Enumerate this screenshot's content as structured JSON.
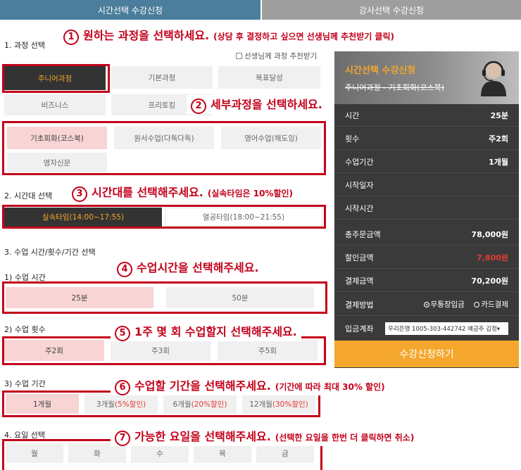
{
  "tabs": [
    "시간선택 수강신청",
    "강사선택 수강신청"
  ],
  "callouts": {
    "c1": {
      "num": "1",
      "text": "원하는 과정을 선택하세요.",
      "note": "(상담 후 결정하고 싶으면 선생님께 추천받기 클릭)"
    },
    "c2": {
      "num": "2",
      "text": "세부과정을 선택하세요.",
      "note": ""
    },
    "c3": {
      "num": "3",
      "text": "시간대를 선택해주세요.",
      "note": "(실속타임은 10%할인)"
    },
    "c4": {
      "num": "4",
      "text": "수업시간을 선택해주세요.",
      "note": ""
    },
    "c5": {
      "num": "5",
      "text": "1주 몇 회 수업할지 선택해주세요.",
      "note": ""
    },
    "c6": {
      "num": "6",
      "text": "수업할 기간을 선택해주세요.",
      "note": "(기간에 따라 최대 30% 할인)"
    },
    "c7": {
      "num": "7",
      "text": "가능한 요일을 선택해주세요.",
      "note": "(선택한 요일을 한번 더 클릭하면 취소)"
    }
  },
  "sections": {
    "course": "1. 과정 선택",
    "time_zone": "2. 시간대 선택",
    "lesson": "3. 수업 시간/횟수/기간 선택",
    "lesson_time": "1) 수업 시간",
    "lesson_count": "2) 수업 횟수",
    "lesson_period": "3) 수업 기간",
    "day": "4. 요일 선택"
  },
  "recommend_checkbox": "선생님께 과정 추천받기",
  "courses": [
    "주니어과정",
    "기본과정",
    "목표달성",
    "비즈니스",
    "프리토킹"
  ],
  "sub_courses": [
    "기초회화(코스북)",
    "원서수업(다독다독)",
    "영어수업(해도잉)",
    "영자신문"
  ],
  "time_zones": [
    "실속타임(14:00~17:55)",
    "열공타임(18:00~21:55)"
  ],
  "lesson_times": [
    "25분",
    "50분"
  ],
  "lesson_counts": [
    "주2회",
    "주3회",
    "주5회"
  ],
  "periods": [
    {
      "label": "1개월",
      "discount": ""
    },
    {
      "label": "3개월",
      "discount": "(5%할인)"
    },
    {
      "label": "6개월",
      "discount": "(20%할인)"
    },
    {
      "label": "12개월",
      "discount": "(30%할인)"
    }
  ],
  "days": [
    "월",
    "화",
    "수",
    "목",
    "금"
  ],
  "panel": {
    "title": "시간선택 수강신청",
    "subtitle": "주니어과정 - 기초회화(코스북)",
    "rows": [
      {
        "label": "시간",
        "value": "25분"
      },
      {
        "label": "횟수",
        "value": "주2회"
      },
      {
        "label": "수업기간",
        "value": "1개월"
      },
      {
        "label": "시작일자",
        "value": ""
      },
      {
        "label": "시작시간",
        "value": ""
      },
      {
        "label": "총주문금액",
        "value": "78,000원"
      },
      {
        "label": "할인금액",
        "value": "7,800원"
      },
      {
        "label": "결제금액",
        "value": "70,200원"
      }
    ],
    "payment_label": "결제방법",
    "payment_options": [
      "무통장입금",
      "카드결제"
    ],
    "account_label": "입금계좌",
    "account_value": "우리은행 1005-303-442742 예금주 김정▾",
    "apply_button": "수강신청하기"
  },
  "colors": {
    "accent": "#c3001a",
    "orange": "#f4a72c",
    "panel": "#3a3a3a",
    "tab_active": "#4b7d9c"
  }
}
